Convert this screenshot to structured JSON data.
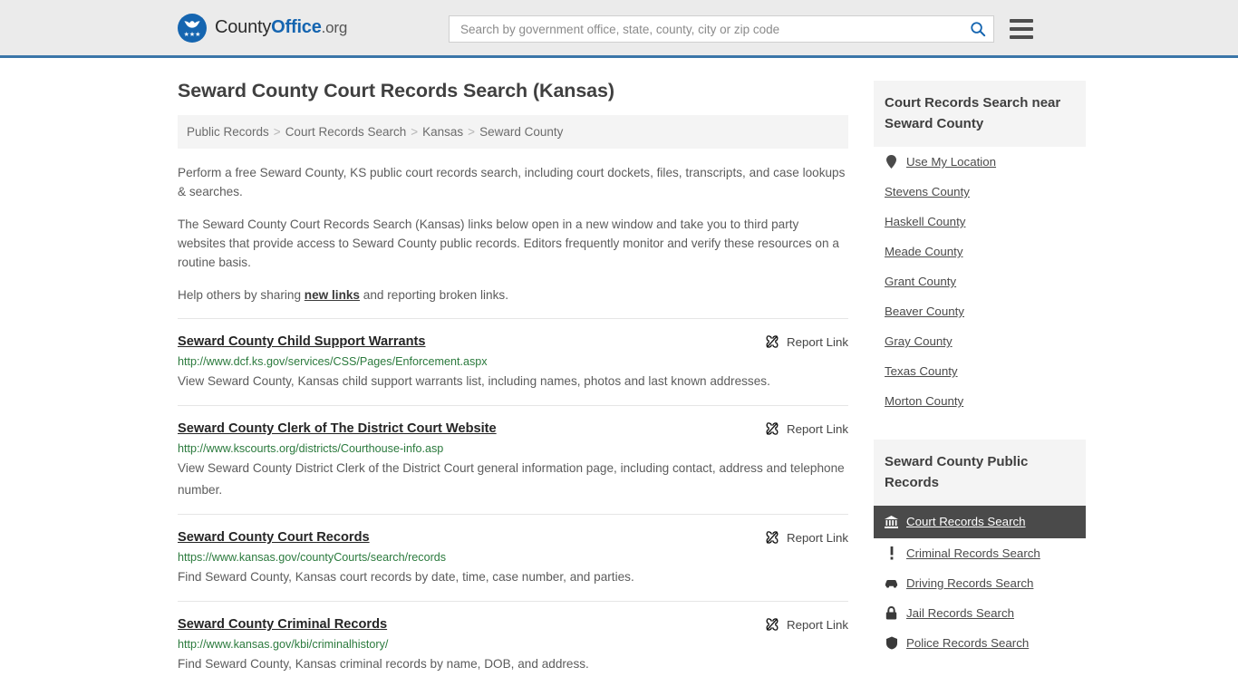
{
  "header": {
    "logo": {
      "icon": "countyoffice-eagle-logo",
      "text_county": "County",
      "text_office": "Office",
      "text_org": ".org",
      "stars": "★★★"
    },
    "search": {
      "placeholder": "Search by government office, state, county, city or zip code",
      "value": "",
      "icon": "search-icon"
    },
    "menu_icon": "hamburger-menu-icon"
  },
  "page_title": "Seward County Court Records Search (Kansas)",
  "breadcrumb": {
    "separator": ">",
    "items": [
      {
        "label": "Public Records"
      },
      {
        "label": "Court Records Search"
      },
      {
        "label": "Kansas"
      },
      {
        "label": "Seward County"
      }
    ]
  },
  "intro": {
    "p1": "Perform a free Seward County, KS public court records search, including court dockets, files, transcripts, and case lookups & searches.",
    "p2": "The Seward County Court Records Search (Kansas) links below open in a new window and take you to third party websites that provide access to Seward County public records. Editors frequently monitor and verify these resources on a routine basis.",
    "p3_before": "Help others by sharing ",
    "p3_link": "new links",
    "p3_after": " and reporting broken links."
  },
  "report_link_label": "Report Link",
  "report_link_icon": "broken-chain-icon",
  "results": [
    {
      "title": "Seward County Child Support Warrants",
      "url": "http://www.dcf.ks.gov/services/CSS/Pages/Enforcement.aspx",
      "description": "View Seward County, Kansas child support warrants list, including names, photos and last known addresses."
    },
    {
      "title": "Seward County Clerk of The District Court Website",
      "url": "http://www.kscourts.org/districts/Courthouse-info.asp",
      "description": "View Seward County District Clerk of the District Court general information page, including contact, address and telephone number."
    },
    {
      "title": "Seward County Court Records",
      "url": "https://www.kansas.gov/countyCourts/search/records",
      "description": "Find Seward County, Kansas court records by date, time, case number, and parties."
    },
    {
      "title": "Seward County Criminal Records",
      "url": "http://www.kansas.gov/kbi/criminalhistory/",
      "description": "Find Seward County, Kansas criminal records by name, DOB, and address."
    }
  ],
  "sidebar": {
    "nearby": {
      "heading": "Court Records Search near Seward County",
      "items": [
        {
          "label": "Use My Location",
          "icon": "map-pin-icon"
        },
        {
          "label": "Stevens County",
          "icon": ""
        },
        {
          "label": "Haskell County",
          "icon": ""
        },
        {
          "label": "Meade County",
          "icon": ""
        },
        {
          "label": "Grant County",
          "icon": ""
        },
        {
          "label": "Beaver County",
          "icon": ""
        },
        {
          "label": "Gray County",
          "icon": ""
        },
        {
          "label": "Texas County",
          "icon": ""
        },
        {
          "label": "Morton County",
          "icon": ""
        }
      ]
    },
    "public_records": {
      "heading": "Seward County Public Records",
      "items": [
        {
          "label": "Court Records Search",
          "icon": "courthouse-icon",
          "active": true
        },
        {
          "label": "Criminal Records Search",
          "icon": "exclamation-icon",
          "active": false
        },
        {
          "label": "Driving Records Search",
          "icon": "car-icon",
          "active": false
        },
        {
          "label": "Jail Records Search",
          "icon": "lock-icon",
          "active": false
        },
        {
          "label": "Police Records Search",
          "icon": "police-badge-icon",
          "active": false
        }
      ]
    }
  },
  "colors": {
    "brand_blue": "#1565b0",
    "header_rule": "#3b76a8",
    "url_green": "#2b7a3d",
    "active_bg": "#4a4a4a",
    "panel_bg": "#f4f4f4"
  }
}
